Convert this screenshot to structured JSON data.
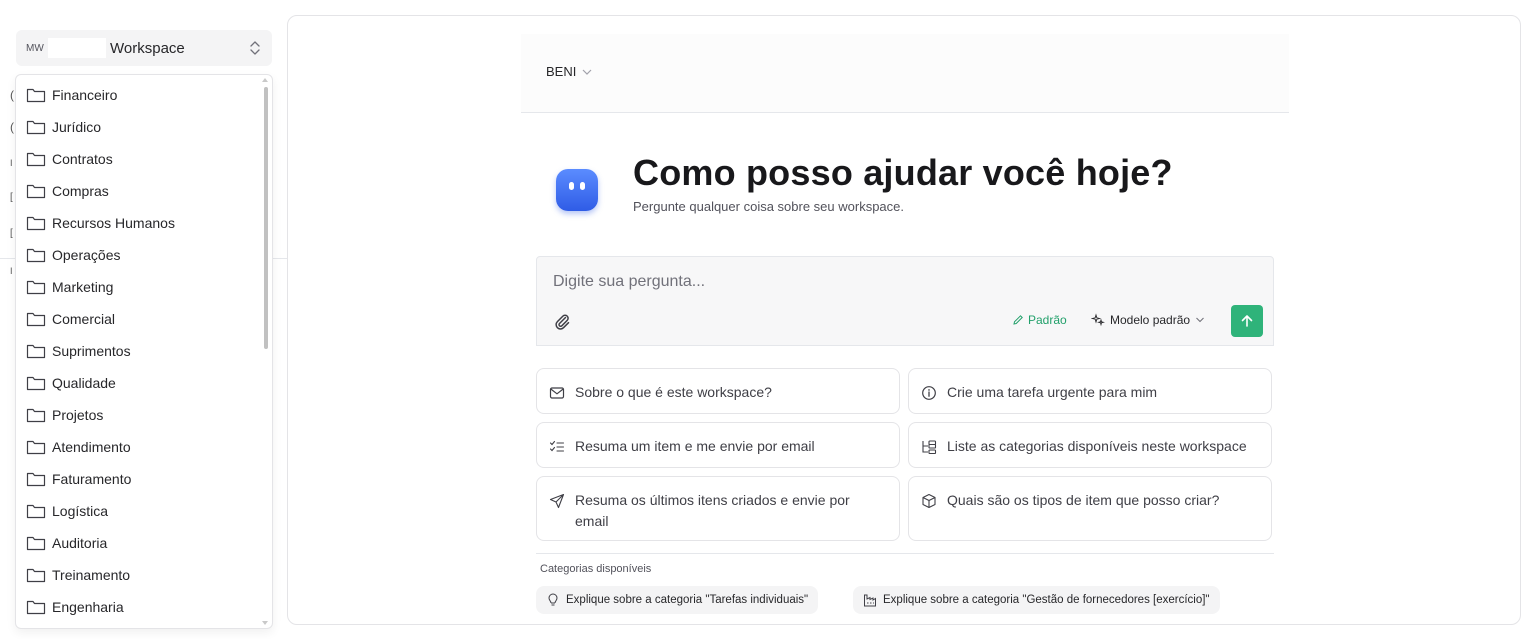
{
  "workspace_selector": {
    "initials": "MW",
    "name": "Workspace"
  },
  "sidebar_peek": [
    "(",
    "(",
    "I",
    "[",
    "[",
    "I"
  ],
  "dropdown": {
    "items": [
      "Financeiro",
      "Jurídico",
      "Contratos",
      "Compras",
      "Recursos Humanos",
      "Operações",
      "Marketing",
      "Comercial",
      "Suprimentos",
      "Qualidade",
      "Projetos",
      "Atendimento",
      "Faturamento",
      "Logística",
      "Auditoria",
      "Treinamento",
      "Engenharia"
    ],
    "icon": "folder-icon"
  },
  "topbar": {
    "agent": "BENI"
  },
  "hero": {
    "title": "Como posso ajudar você hoje?",
    "subtitle": "Pergunte qualquer coisa sobre seu workspace."
  },
  "composer": {
    "placeholder": "Digite sua pergunta...",
    "mode_label": "Padrão",
    "model_label": "Modelo padrão"
  },
  "suggestions": [
    {
      "label": "Sobre o que é este workspace?",
      "icon": "mail-icon"
    },
    {
      "label": "Crie uma tarefa urgente para mim",
      "icon": "info-icon"
    },
    {
      "label": "Resuma um item e me envie por email",
      "icon": "checklist-icon"
    },
    {
      "label": "Liste as categorias disponíveis neste workspace",
      "icon": "tree-icon"
    },
    {
      "label": "Resuma os últimos itens criados e envie por email",
      "icon": "send-icon"
    },
    {
      "label": "Quais são os tipos de item que posso criar?",
      "icon": "box-icon"
    }
  ],
  "categories": {
    "label": "Categorias disponíveis",
    "chips": [
      {
        "label": "Explique sobre a categoria \"Tarefas individuais\"",
        "icon": "lightbulb-icon"
      },
      {
        "label": "Explique sobre a categoria \"Gestão de fornecedores [exercício]\"",
        "icon": "factory-icon"
      }
    ]
  },
  "colors": {
    "accent_green": "#2fb37a",
    "mode_green": "#22a06b",
    "avatar_blue": "#3b6cf0"
  }
}
